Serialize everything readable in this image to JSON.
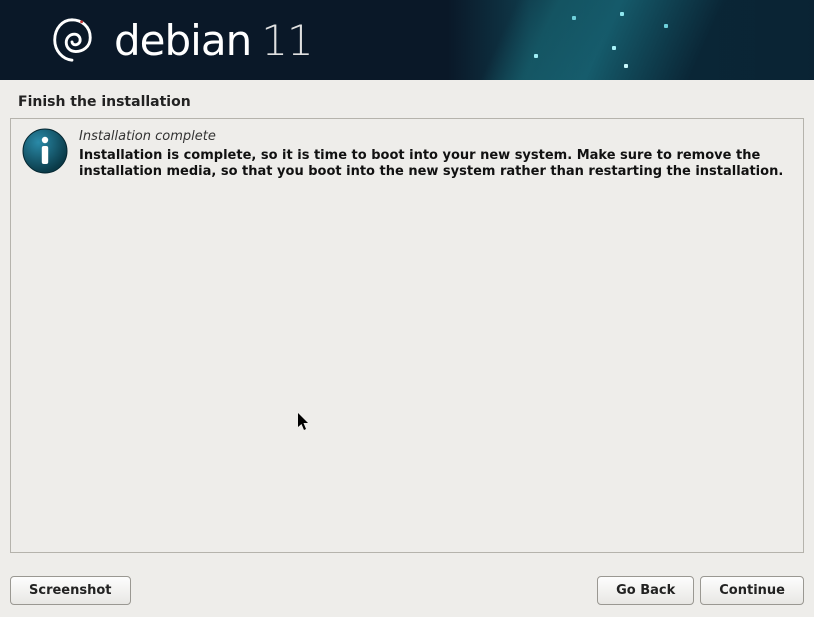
{
  "header": {
    "brand": "debian",
    "version": "11"
  },
  "page_title": "Finish the installation",
  "message": {
    "heading": "Installation complete",
    "body": "Installation is complete, so it is time to boot into your new system. Make sure to remove the installation media, so that you boot into the new system rather than restarting the installation."
  },
  "buttons": {
    "screenshot": "Screenshot",
    "go_back": "Go Back",
    "continue": "Continue"
  }
}
